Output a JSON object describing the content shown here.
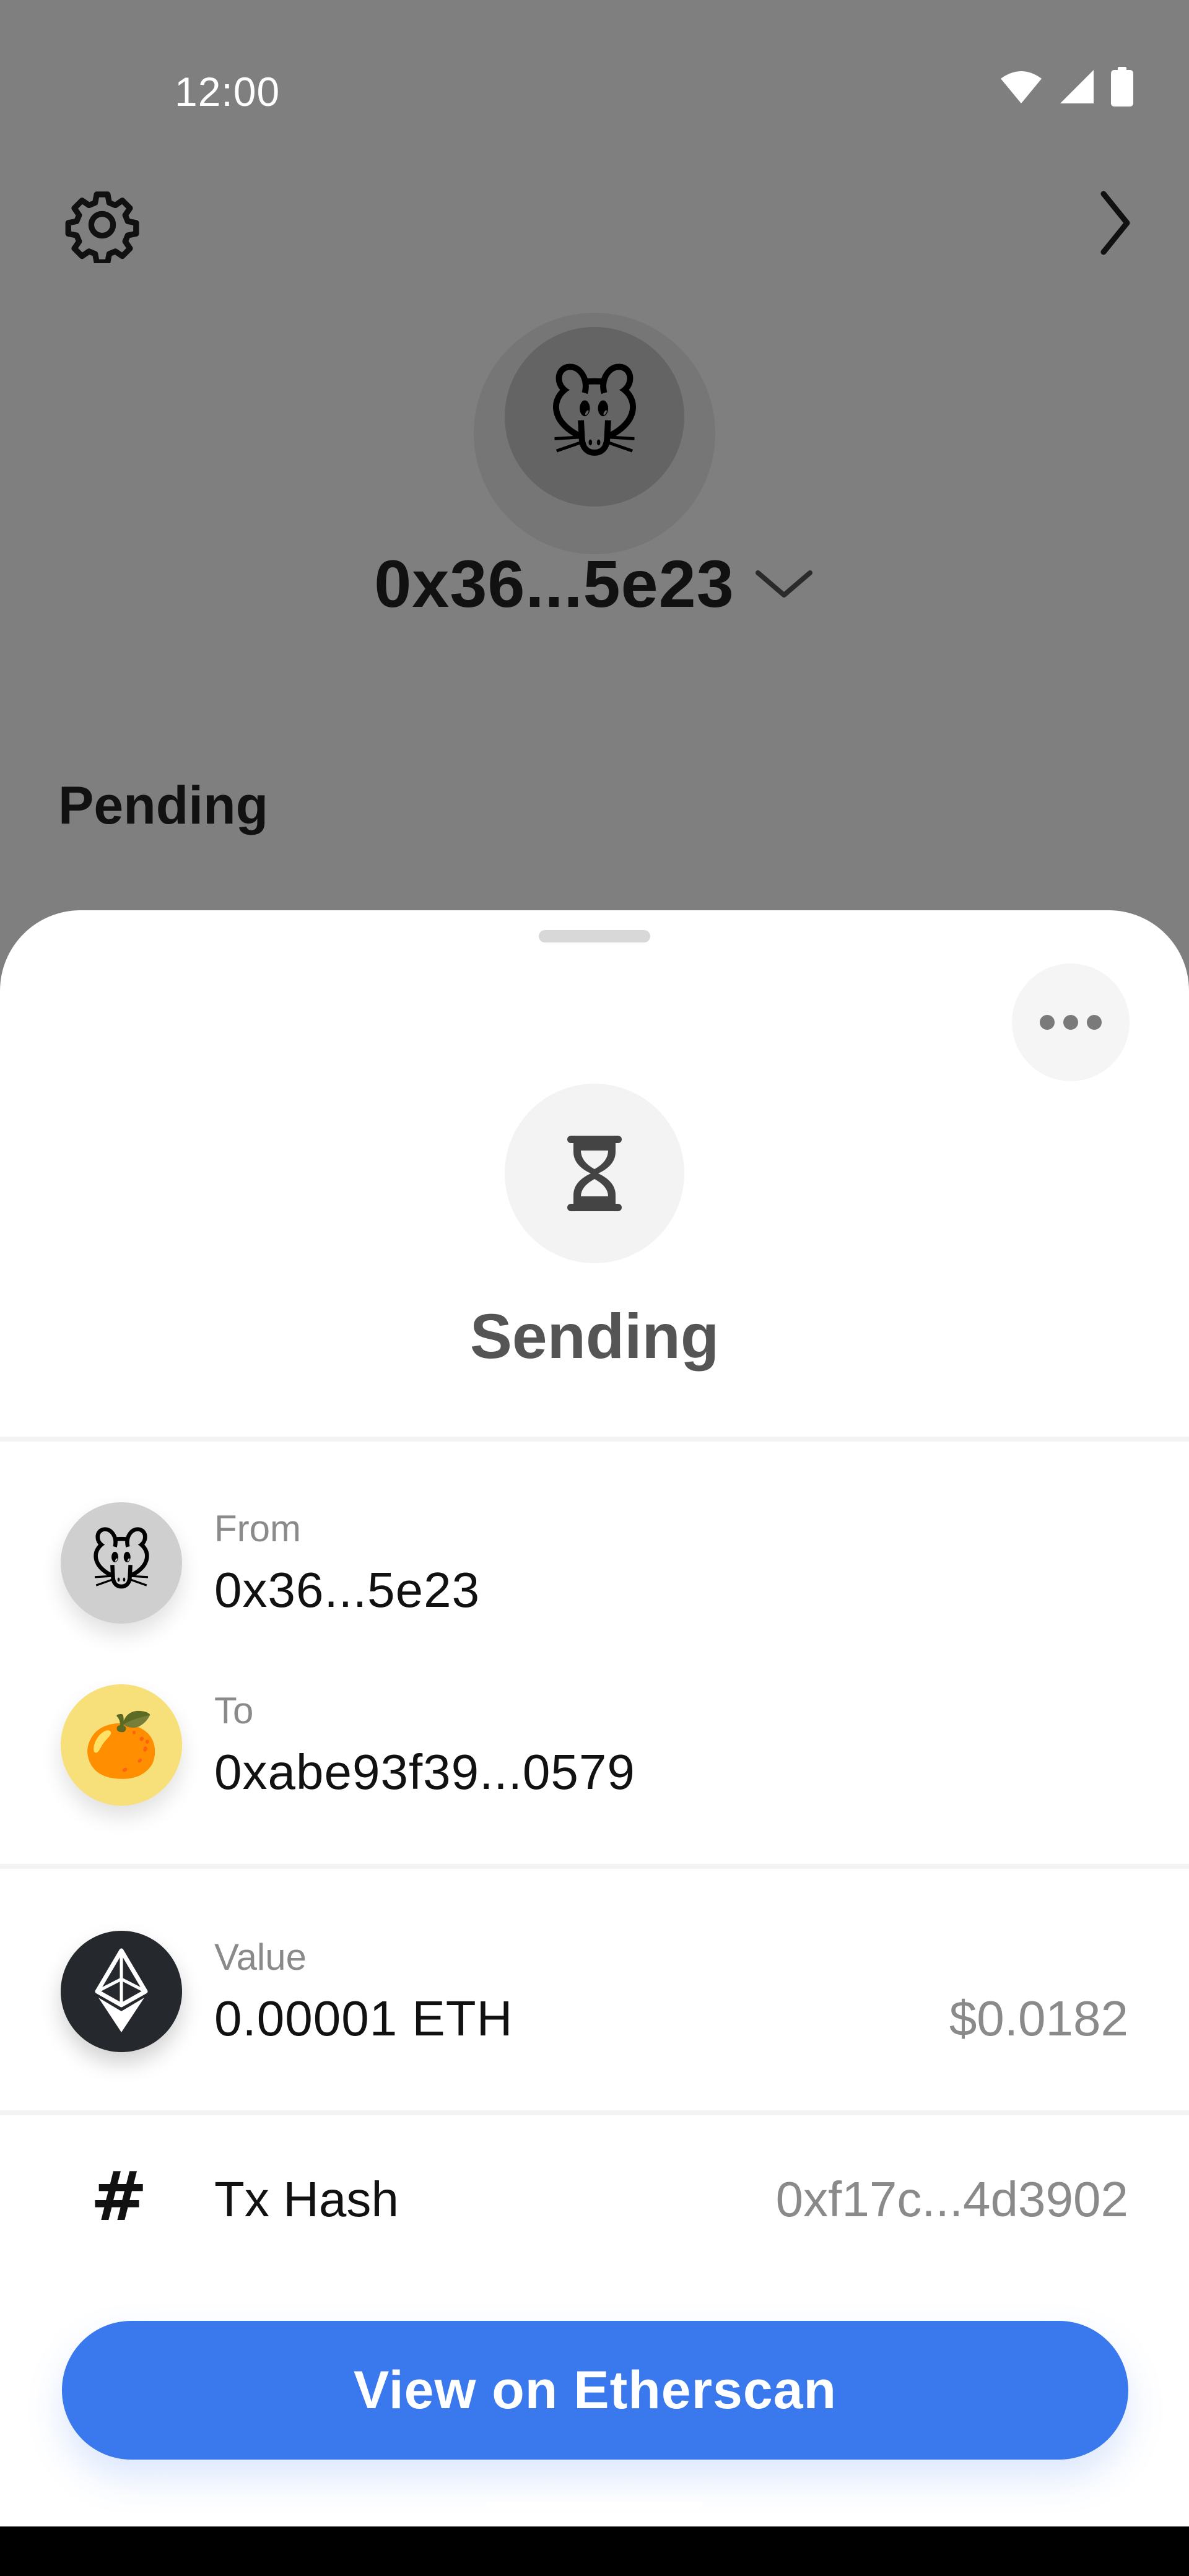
{
  "status_bar": {
    "time": "12:00",
    "icons": [
      "wifi-icon",
      "cell-signal-icon",
      "battery-icon"
    ]
  },
  "header": {
    "settings_icon": "gear-icon",
    "next_icon": "chevron-right-icon"
  },
  "account": {
    "avatar_emoji": "🐭",
    "name": "0x36...5e23",
    "dropdown_icon": "chevron-down-icon"
  },
  "background": {
    "section_title": "Pending"
  },
  "sheet": {
    "more_icon": "more-horizontal-icon",
    "status_icon": "hourglass-icon",
    "status_title": "Sending",
    "from": {
      "label": "From",
      "value": "0x36...5e23",
      "avatar_emoji": "🐭"
    },
    "to": {
      "label": "To",
      "value": "0xabe93f39...0579",
      "avatar_emoji": "🍊"
    },
    "value": {
      "label": "Value",
      "amount": "0.00001 ETH",
      "fiat": "$0.0182",
      "icon": "ethereum-icon"
    },
    "tx_hash": {
      "icon": "#",
      "label": "Tx Hash",
      "value": "0xf17c...4d3902"
    },
    "cta_label": "View on Etherscan"
  },
  "colors": {
    "accent": "#3a78ee",
    "overlay": "#000000",
    "sheet_bg": "#ffffff",
    "to_avatar_bg": "#f7e07a",
    "from_avatar_bg": "#cfcfcf"
  }
}
